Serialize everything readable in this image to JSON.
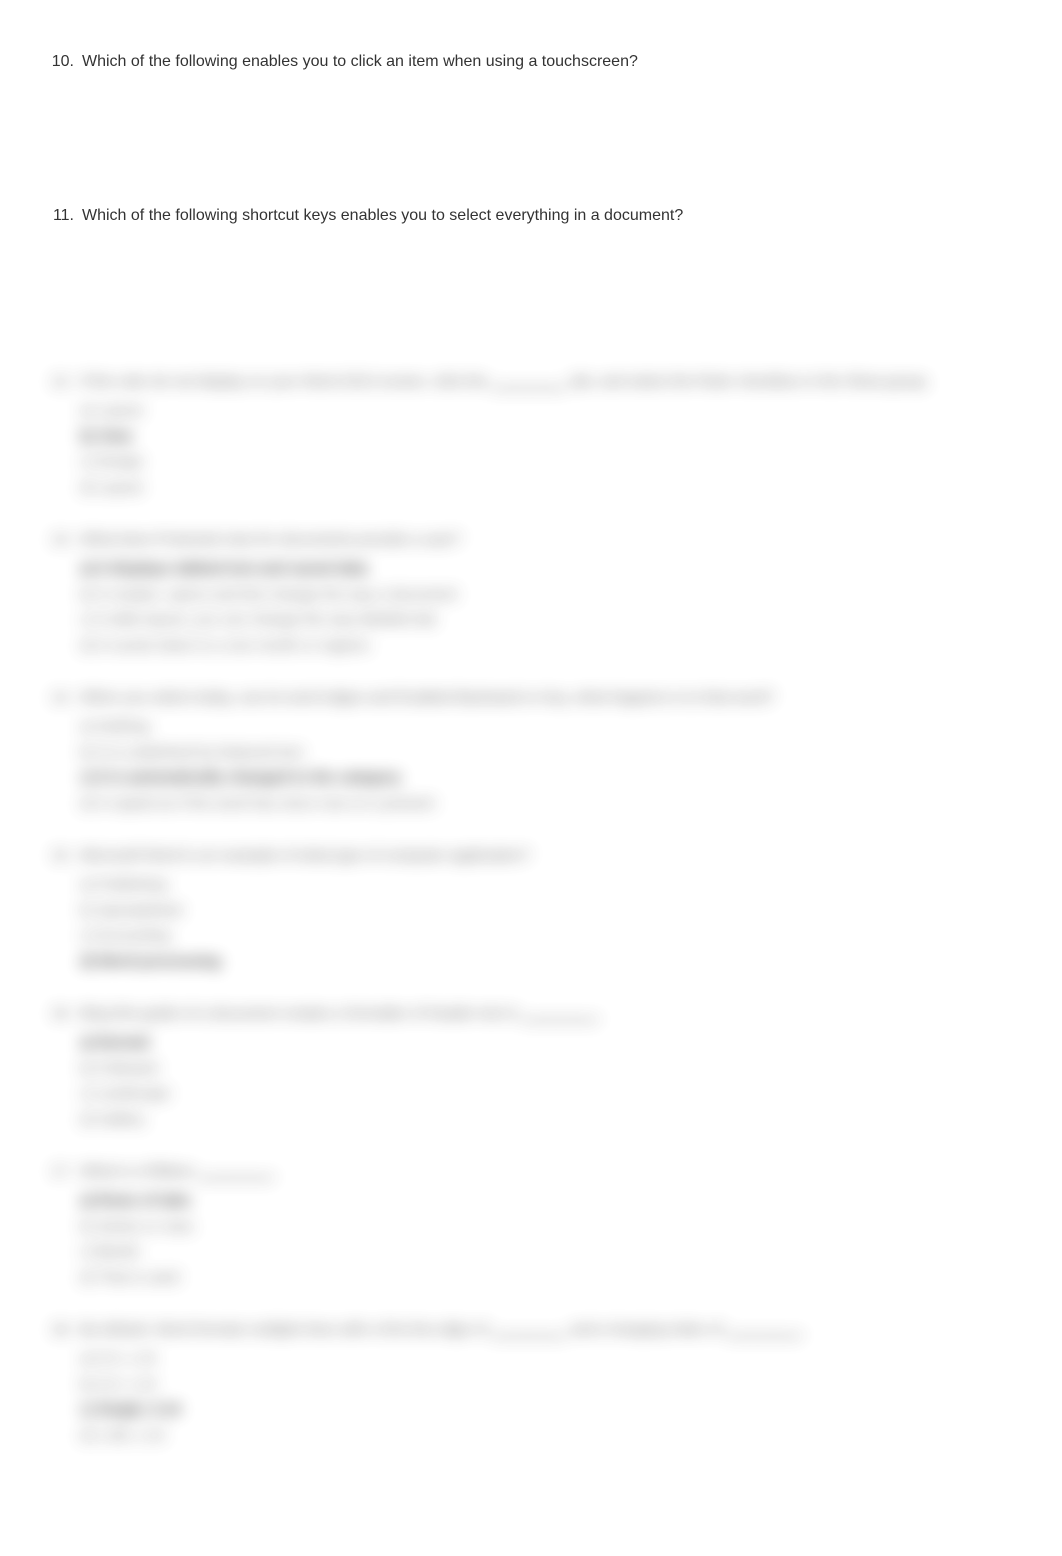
{
  "questions": [
    {
      "number": "10.",
      "text": "Which of the following enables you to click an item when using a touchscreen?"
    },
    {
      "number": "11.",
      "text": "Which of the following shortcut keys enables you to select everything in a document?"
    }
  ],
  "blurred": [
    {
      "number": "12.",
      "text_parts": [
        "If the ruler do not display on your Word 2013 screen, click the ",
        "________",
        " tab, and select the Ruler checkbox in the Show group."
      ],
      "options": [
        {
          "text": "a) Layout",
          "bold": false
        },
        {
          "text": "b) View",
          "bold": true
        },
        {
          "text": "c) Design",
          "bold": false
        },
        {
          "text": "d) Layout",
          "bold": false
        }
      ]
    },
    {
      "number": "13.",
      "text_parts": [
        "What does Protected view for documents provide a user?"
      ],
      "options": [
        {
          "text": "a) It displays tabbed text and saved data",
          "bold": true
        },
        {
          "text": "b) It creates, opens and lets change the way a document",
          "bold": false
        },
        {
          "text": "c) It edits layout, you can change the way labelled tab",
          "bold": false
        },
        {
          "text": "d) It counts down to a one month or regions",
          "bold": false
        }
      ]
    },
    {
      "number": "14.",
      "text_parts": [
        "When you select today, use its word edges and Enabled Backward or key, what happens is to that word?"
      ],
      "options": [
        {
          "text": "a) Nothing",
          "bold": false
        },
        {
          "text": "b) It is underlined by featured text",
          "bold": false
        },
        {
          "text": "c) It is automatically changed to the category",
          "bold": true
        },
        {
          "text": "d) It copied as if the word has since now on a present",
          "bold": false
        }
      ]
    },
    {
      "number": "15.",
      "text_parts": [
        "Microsoft Word is an example of what type of computer application?"
      ],
      "options": [
        {
          "text": "a) Publishing",
          "bold": false
        },
        {
          "text": "b) Spreadsheet",
          "bold": false
        },
        {
          "text": "c) Accounting",
          "bold": false
        },
        {
          "text": "d) Word processing",
          "bold": true
        }
      ]
    },
    {
      "number": "16.",
      "text_parts": [
        "Bing this guide of a document creates a formatter of header text is ",
        "________",
        "."
      ],
      "options": [
        {
          "text": "a) Normal",
          "bold": true
        },
        {
          "text": "b) Followed",
          "bold": false
        },
        {
          "text": "c) Landscape",
          "bold": false
        },
        {
          "text": "d) Gallery",
          "bold": false
        }
      ]
    },
    {
      "number": "17.",
      "text_parts": [
        "What is a Ribbon ",
        "________",
        "."
      ],
      "options": [
        {
          "text": "a) Rows of tabs",
          "bold": true
        },
        {
          "text": "b) Series or rows",
          "bold": false
        },
        {
          "text": "c) Bands",
          "bold": false
        },
        {
          "text": "d) That is used",
          "bold": false
        }
      ]
    },
    {
      "number": "18.",
      "text_parts": [
        "By default, Word formats multiple lines with a first line align of ",
        "________",
        " and a hanging index of ",
        "________",
        "."
      ],
      "options": [
        {
          "text": "a) 0.5; 1.15",
          "bold": false
        },
        {
          "text": "b) 0.5; 1.10",
          "bold": false
        },
        {
          "text": "c) Single; 0.10",
          "bold": true
        },
        {
          "text": "d) 1.08; 1.10",
          "bold": false
        }
      ]
    }
  ],
  "page_number_position": 1183
}
